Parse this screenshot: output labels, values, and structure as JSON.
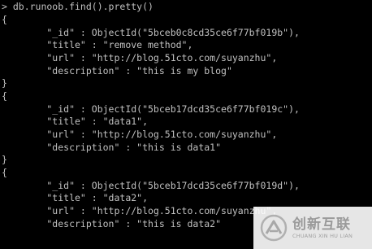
{
  "console": {
    "lines": [
      "> db.runoob.find().pretty()",
      "{",
      "        \"_id\" : ObjectId(\"5bceb0c8cd35ce6f77bf019b\"),",
      "        \"title\" : \"remove method\",",
      "        \"url\" : \"http://blog.51cto.com/suyanzhu\",",
      "        \"description\" : \"this is my blog\"",
      "}",
      "{",
      "        \"_id\" : ObjectId(\"5bceb17dcd35ce6f77bf019c\"),",
      "        \"title\" : \"data1\",",
      "        \"url\" : \"http://blog.51cto.com/suyanzhu\",",
      "        \"description\" : \"this is data1\"",
      "}",
      "{",
      "        \"_id\" : ObjectId(\"5bceb17dcd35ce6f77bf019d\"),",
      "        \"title\" : \"data2\",",
      "        \"url\" : \"http://blog.51cto.com/suyanzhu\",",
      "        \"description\" : \"this is data2\""
    ]
  },
  "watermark": {
    "main": "创新互联",
    "sub": "CHUANG XIN HU LIAN"
  },
  "colors": {
    "background": "#000000",
    "text": "#c0c0c0"
  }
}
